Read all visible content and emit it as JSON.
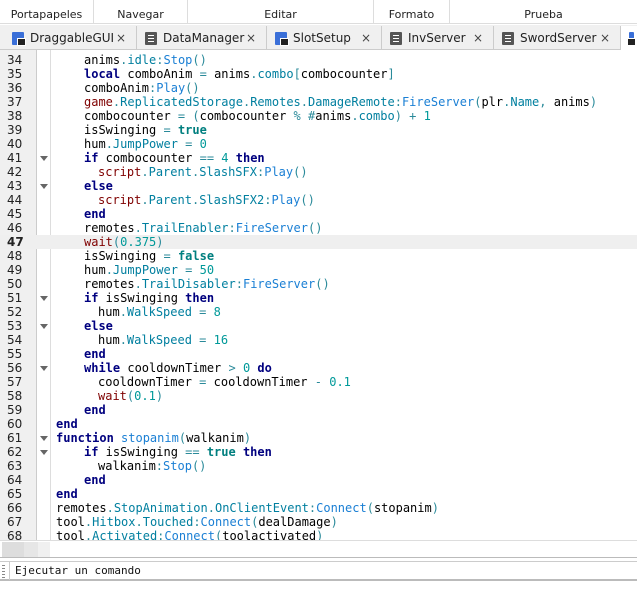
{
  "ribbon": [
    "Portapapeles",
    "Navegar",
    "Editar",
    "Formato",
    "Prueba"
  ],
  "tabs": [
    {
      "label": "DraggableGUI",
      "icon": "local-script-icon"
    },
    {
      "label": "DataManager",
      "icon": "script-icon"
    },
    {
      "label": "SlotSetup",
      "icon": "local-script-icon"
    },
    {
      "label": "InvServer",
      "icon": "script-icon"
    },
    {
      "label": "SwordServer",
      "icon": "script-icon"
    }
  ],
  "tab_close": "×",
  "current_line": 47,
  "code": [
    {
      "n": 34,
      "ind": 2,
      "t": [
        [
          "i",
          "anims"
        ],
        [
          "o",
          "."
        ],
        [
          "p",
          "idle"
        ],
        [
          "o",
          ":"
        ],
        [
          "m",
          "Stop"
        ],
        [
          "o",
          "()"
        ]
      ]
    },
    {
      "n": 35,
      "ind": 2,
      "t": [
        [
          "k",
          "local"
        ],
        [
          "i",
          " comboAnim "
        ],
        [
          "o",
          "="
        ],
        [
          "i",
          " anims"
        ],
        [
          "o",
          "."
        ],
        [
          "p",
          "combo"
        ],
        [
          "o",
          "["
        ],
        [
          "i",
          "combocounter"
        ],
        [
          "o",
          "]"
        ]
      ]
    },
    {
      "n": 36,
      "ind": 2,
      "t": [
        [
          "i",
          "comboAnim"
        ],
        [
          "o",
          ":"
        ],
        [
          "m",
          "Play"
        ],
        [
          "o",
          "()"
        ]
      ]
    },
    {
      "n": 37,
      "ind": 2,
      "t": [
        [
          "b",
          "game"
        ],
        [
          "o",
          "."
        ],
        [
          "p",
          "ReplicatedStorage"
        ],
        [
          "o",
          "."
        ],
        [
          "p",
          "Remotes"
        ],
        [
          "o",
          "."
        ],
        [
          "p",
          "DamageRemote"
        ],
        [
          "o",
          ":"
        ],
        [
          "m",
          "FireServer"
        ],
        [
          "o",
          "("
        ],
        [
          "i",
          "plr"
        ],
        [
          "o",
          "."
        ],
        [
          "p",
          "Name"
        ],
        [
          "o",
          ","
        ],
        [
          "i",
          " anims"
        ],
        [
          "o",
          ")"
        ]
      ]
    },
    {
      "n": 38,
      "ind": 2,
      "t": [
        [
          "i",
          "combocounter "
        ],
        [
          "o",
          "="
        ],
        [
          "o",
          " ("
        ],
        [
          "i",
          "combocounter "
        ],
        [
          "o",
          "%"
        ],
        [
          "o",
          " #"
        ],
        [
          "i",
          "anims"
        ],
        [
          "o",
          "."
        ],
        [
          "p",
          "combo"
        ],
        [
          "o",
          ")"
        ],
        [
          "o",
          " +"
        ],
        [
          "n",
          " 1"
        ]
      ]
    },
    {
      "n": 39,
      "ind": 2,
      "t": [
        [
          "i",
          "isSwinging "
        ],
        [
          "o",
          "="
        ],
        [
          "t",
          " true"
        ]
      ]
    },
    {
      "n": 40,
      "ind": 2,
      "t": [
        [
          "i",
          "hum"
        ],
        [
          "o",
          "."
        ],
        [
          "p",
          "JumpPower"
        ],
        [
          "o",
          " ="
        ],
        [
          "n",
          " 0"
        ]
      ]
    },
    {
      "n": 41,
      "ind": 2,
      "fold": true,
      "t": [
        [
          "k",
          "if"
        ],
        [
          "i",
          " combocounter "
        ],
        [
          "o",
          "=="
        ],
        [
          "n",
          " 4"
        ],
        [
          "k",
          " then"
        ]
      ]
    },
    {
      "n": 42,
      "ind": 3,
      "t": [
        [
          "b",
          "script"
        ],
        [
          "o",
          "."
        ],
        [
          "p",
          "Parent"
        ],
        [
          "o",
          "."
        ],
        [
          "p",
          "SlashSFX"
        ],
        [
          "o",
          ":"
        ],
        [
          "m",
          "Play"
        ],
        [
          "o",
          "()"
        ]
      ]
    },
    {
      "n": 43,
      "ind": 2,
      "fold": true,
      "t": [
        [
          "k",
          "else"
        ]
      ]
    },
    {
      "n": 44,
      "ind": 3,
      "t": [
        [
          "b",
          "script"
        ],
        [
          "o",
          "."
        ],
        [
          "p",
          "Parent"
        ],
        [
          "o",
          "."
        ],
        [
          "p",
          "SlashSFX2"
        ],
        [
          "o",
          ":"
        ],
        [
          "m",
          "Play"
        ],
        [
          "o",
          "()"
        ]
      ]
    },
    {
      "n": 45,
      "ind": 2,
      "t": [
        [
          "k",
          "end"
        ]
      ]
    },
    {
      "n": 46,
      "ind": 2,
      "t": [
        [
          "i",
          "remotes"
        ],
        [
          "o",
          "."
        ],
        [
          "p",
          "TrailEnabler"
        ],
        [
          "o",
          ":"
        ],
        [
          "m",
          "FireServer"
        ],
        [
          "o",
          "()"
        ]
      ]
    },
    {
      "n": 47,
      "ind": 2,
      "t": [
        [
          "b",
          "wait"
        ],
        [
          "o",
          "("
        ],
        [
          "n",
          "0.375"
        ],
        [
          "o",
          ")"
        ]
      ]
    },
    {
      "n": 48,
      "ind": 2,
      "t": [
        [
          "i",
          "isSwinging "
        ],
        [
          "o",
          "="
        ],
        [
          "t",
          " false"
        ]
      ]
    },
    {
      "n": 49,
      "ind": 2,
      "t": [
        [
          "i",
          "hum"
        ],
        [
          "o",
          "."
        ],
        [
          "p",
          "JumpPower"
        ],
        [
          "o",
          " ="
        ],
        [
          "n",
          " 50"
        ]
      ]
    },
    {
      "n": 50,
      "ind": 2,
      "t": [
        [
          "i",
          "remotes"
        ],
        [
          "o",
          "."
        ],
        [
          "p",
          "TrailDisabler"
        ],
        [
          "o",
          ":"
        ],
        [
          "m",
          "FireServer"
        ],
        [
          "o",
          "()"
        ]
      ]
    },
    {
      "n": 51,
      "ind": 2,
      "fold": true,
      "t": [
        [
          "k",
          "if"
        ],
        [
          "i",
          " isSwinging "
        ],
        [
          "k",
          "then"
        ]
      ]
    },
    {
      "n": 52,
      "ind": 3,
      "t": [
        [
          "i",
          "hum"
        ],
        [
          "o",
          "."
        ],
        [
          "p",
          "WalkSpeed"
        ],
        [
          "o",
          " ="
        ],
        [
          "n",
          " 8"
        ]
      ]
    },
    {
      "n": 53,
      "ind": 2,
      "fold": true,
      "t": [
        [
          "k",
          "else"
        ]
      ]
    },
    {
      "n": 54,
      "ind": 3,
      "t": [
        [
          "i",
          "hum"
        ],
        [
          "o",
          "."
        ],
        [
          "p",
          "WalkSpeed"
        ],
        [
          "o",
          " ="
        ],
        [
          "n",
          " 16"
        ]
      ]
    },
    {
      "n": 55,
      "ind": 2,
      "t": [
        [
          "k",
          "end"
        ]
      ]
    },
    {
      "n": 56,
      "ind": 2,
      "fold": true,
      "t": [
        [
          "k",
          "while"
        ],
        [
          "i",
          " cooldownTimer "
        ],
        [
          "o",
          ">"
        ],
        [
          "n",
          " 0"
        ],
        [
          "k",
          " do"
        ]
      ]
    },
    {
      "n": 57,
      "ind": 3,
      "t": [
        [
          "i",
          "cooldownTimer "
        ],
        [
          "o",
          "="
        ],
        [
          "i",
          " cooldownTimer "
        ],
        [
          "o",
          "-"
        ],
        [
          "n",
          " 0.1"
        ]
      ]
    },
    {
      "n": 58,
      "ind": 3,
      "t": [
        [
          "b",
          "wait"
        ],
        [
          "o",
          "("
        ],
        [
          "n",
          "0.1"
        ],
        [
          "o",
          ")"
        ]
      ]
    },
    {
      "n": 59,
      "ind": 2,
      "t": [
        [
          "k",
          "end"
        ]
      ]
    },
    {
      "n": 60,
      "ind": 0,
      "t": [
        [
          "k",
          "end"
        ]
      ]
    },
    {
      "n": 61,
      "ind": 0,
      "fold": true,
      "t": [
        [
          "k",
          "function"
        ],
        [
          "m",
          " stopanim"
        ],
        [
          "o",
          "("
        ],
        [
          "i",
          "walkanim"
        ],
        [
          "o",
          ")"
        ]
      ]
    },
    {
      "n": 62,
      "ind": 2,
      "fold": true,
      "t": [
        [
          "k",
          "if"
        ],
        [
          "i",
          " isSwinging "
        ],
        [
          "o",
          "=="
        ],
        [
          "t",
          " true"
        ],
        [
          "k",
          " then"
        ]
      ]
    },
    {
      "n": 63,
      "ind": 3,
      "t": [
        [
          "i",
          "walkanim"
        ],
        [
          "o",
          ":"
        ],
        [
          "m",
          "Stop"
        ],
        [
          "o",
          "()"
        ]
      ]
    },
    {
      "n": 64,
      "ind": 2,
      "t": [
        [
          "k",
          "end"
        ]
      ]
    },
    {
      "n": 65,
      "ind": 0,
      "t": [
        [
          "k",
          "end"
        ]
      ]
    },
    {
      "n": 66,
      "ind": 0,
      "t": [
        [
          "i",
          "remotes"
        ],
        [
          "o",
          "."
        ],
        [
          "p",
          "StopAnimation"
        ],
        [
          "o",
          "."
        ],
        [
          "p",
          "OnClientEvent"
        ],
        [
          "o",
          ":"
        ],
        [
          "m",
          "Connect"
        ],
        [
          "o",
          "("
        ],
        [
          "i",
          "stopanim"
        ],
        [
          "o",
          ")"
        ]
      ]
    },
    {
      "n": 67,
      "ind": 0,
      "t": [
        [
          "i",
          "tool"
        ],
        [
          "o",
          "."
        ],
        [
          "p",
          "Hitbox"
        ],
        [
          "o",
          "."
        ],
        [
          "p",
          "Touched"
        ],
        [
          "o",
          ":"
        ],
        [
          "m",
          "Connect"
        ],
        [
          "o",
          "("
        ],
        [
          "i",
          "dealDamage"
        ],
        [
          "o",
          ")"
        ]
      ]
    },
    {
      "n": 68,
      "ind": 0,
      "t": [
        [
          "i",
          "tool"
        ],
        [
          "o",
          "."
        ],
        [
          "p",
          "Activated"
        ],
        [
          "o",
          ":"
        ],
        [
          "m",
          "Connect"
        ],
        [
          "o",
          "("
        ],
        [
          "i",
          "toolactivated"
        ],
        [
          "o",
          ")"
        ]
      ]
    }
  ],
  "command_bar": {
    "placeholder": "Ejecutar un comando"
  }
}
